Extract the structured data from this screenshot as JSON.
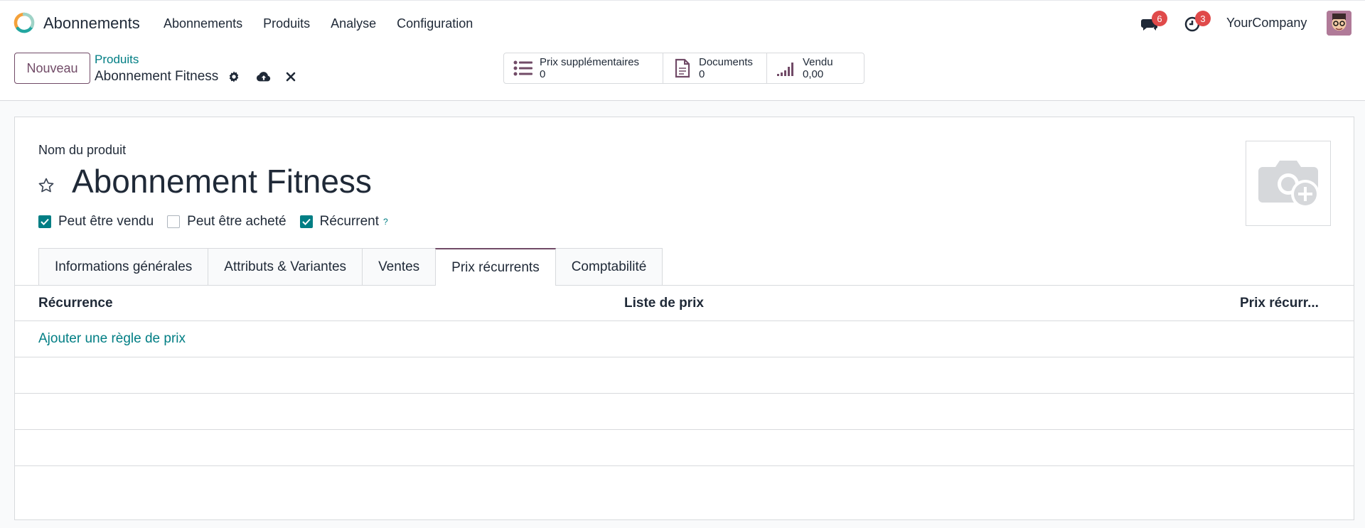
{
  "navbar": {
    "app_title": "Abonnements",
    "menu": [
      "Abonnements",
      "Produits",
      "Analyse",
      "Configuration"
    ],
    "messages_count": "6",
    "activities_count": "3",
    "company": "YourCompany"
  },
  "control": {
    "new_button": "Nouveau",
    "breadcrumb_parent": "Produits",
    "breadcrumb_current": "Abonnement Fitness",
    "smart_buttons": [
      {
        "label": "Prix supplémentaires",
        "value": "0",
        "icon": "list-icon"
      },
      {
        "label": "Documents",
        "value": "0",
        "icon": "document-icon"
      },
      {
        "label": "Vendu",
        "value": "0,00",
        "icon": "signal-chart-icon"
      }
    ]
  },
  "form": {
    "name_label": "Nom du produit",
    "product_name": "Abonnement Fitness",
    "checkboxes": [
      {
        "label": "Peut être vendu",
        "checked": true
      },
      {
        "label": "Peut être acheté",
        "checked": false
      },
      {
        "label": "Récurrent",
        "checked": true,
        "help": "?"
      }
    ],
    "tabs": [
      "Informations générales",
      "Attributs & Variantes",
      "Ventes",
      "Prix récurrents",
      "Comptabilité"
    ],
    "active_tab": "Prix récurrents",
    "table": {
      "columns": [
        "Récurrence",
        "Liste de prix",
        "Prix récurr..."
      ],
      "add_line": "Ajouter une règle de prix"
    }
  },
  "colors": {
    "brand": "#714b67",
    "accent": "#017e84",
    "badge": "#e04a4a"
  }
}
